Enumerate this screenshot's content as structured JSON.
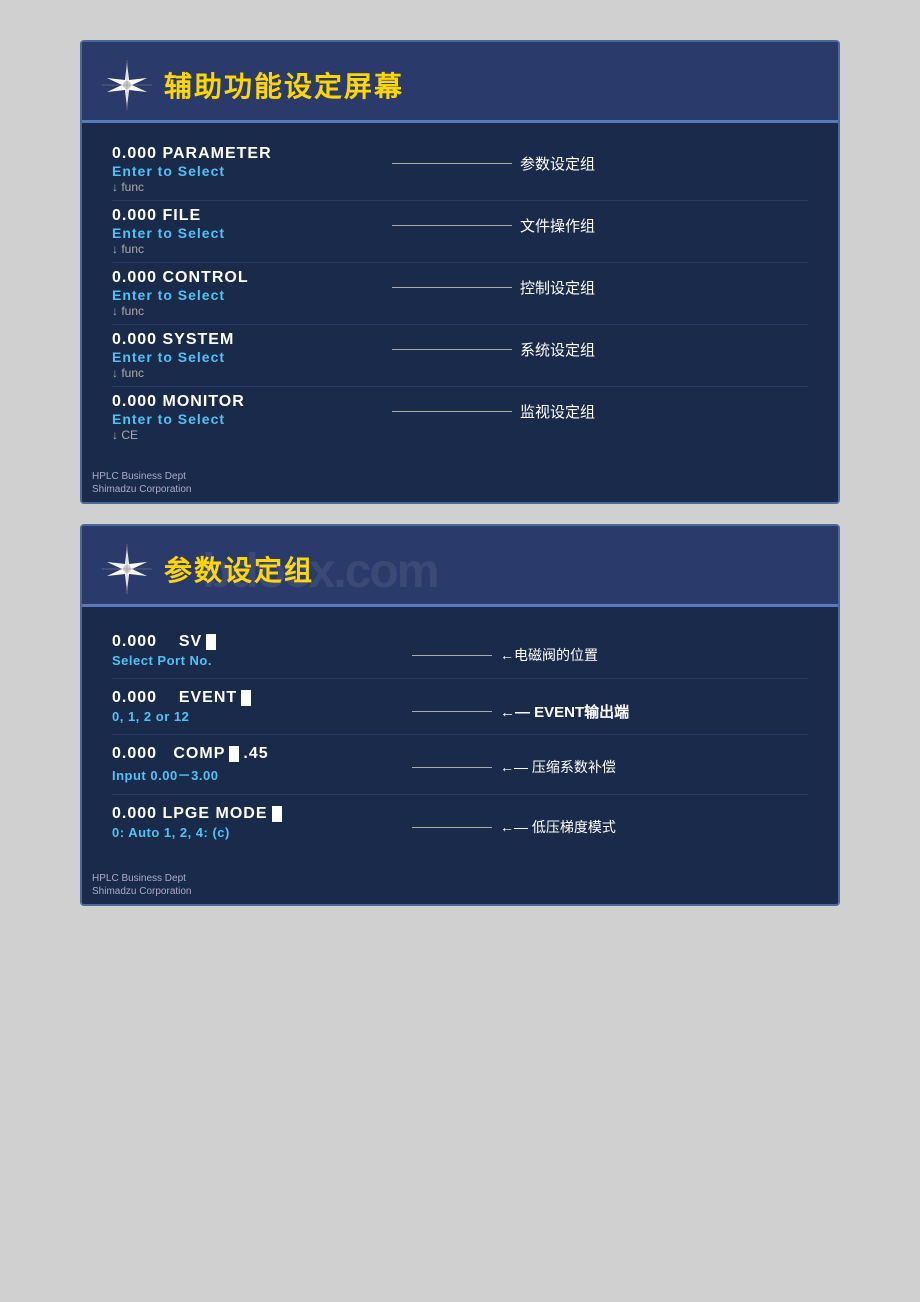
{
  "panel1": {
    "title": "辅助功能设定屏幕",
    "items": [
      {
        "id": "parameter",
        "valueLine": "0.000  PARAMETER",
        "subLine": "Enter  to  Select",
        "funcLine": "↓ func",
        "arrowLabel": "参数设定组"
      },
      {
        "id": "file",
        "valueLine": "0.000  FILE",
        "subLine": "Enter  to  Select",
        "funcLine": "↓ func",
        "arrowLabel": "文件操作组"
      },
      {
        "id": "control",
        "valueLine": "0.000  CONTROL",
        "subLine": "Enter  to  Select",
        "funcLine": "↓ func",
        "arrowLabel": "控制设定组"
      },
      {
        "id": "system",
        "valueLine": "0.000  SYSTEM",
        "subLine": "Enter  to  Select",
        "funcLine": "↓ func",
        "arrowLabel": "系统设定组"
      },
      {
        "id": "monitor",
        "valueLine": "0.000  MONITOR",
        "subLine": "Enter  to  Select",
        "funcLine": "↓ CE",
        "arrowLabel": "监视设定组"
      }
    ],
    "footer1": "HPLC Business Dept",
    "footer2": "Shimadzu Corporation"
  },
  "panel2": {
    "title": "参数设定组",
    "watermark": "bdocx.com",
    "items": [
      {
        "id": "sv",
        "valueLine": "0.000    SV",
        "hasCursor": true,
        "subLine": "Select  Port  No.",
        "arrowLabel": "←电磁阀的位置",
        "arrowLabelBold": false
      },
      {
        "id": "event",
        "valueLine": "0.000    EVENT",
        "hasCursor": true,
        "subLine": "0, 1, 2  or  12",
        "arrowLabel": "←  EVENT输出端",
        "arrowLabelBold": true
      },
      {
        "id": "comp",
        "valueLine": "0.000  COMP",
        "compSuffix": ".45",
        "hasCursor": true,
        "subLine": "Input  0.00－3.00",
        "arrowLabel": "←— 压缩系数补偿",
        "arrowLabelBold": false
      },
      {
        "id": "lpge",
        "valueLine": "0.000  LPGE  MODE",
        "hasCursor": true,
        "subLine": "0: Auto  1, 2, 4: (c)",
        "arrowLabel": "←—  低压梯度模式",
        "arrowLabelBold": false
      }
    ],
    "footer1": "HPLC Business Dept",
    "footer2": "Shimadzu Corporation"
  },
  "icons": {
    "star": "✳"
  }
}
